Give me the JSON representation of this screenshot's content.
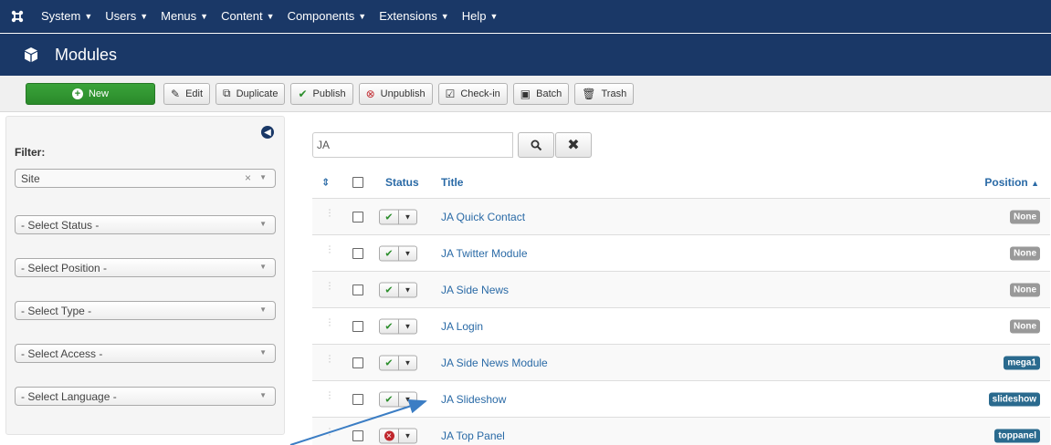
{
  "topnav": {
    "items": [
      {
        "label": "System"
      },
      {
        "label": "Users"
      },
      {
        "label": "Menus"
      },
      {
        "label": "Content"
      },
      {
        "label": "Components"
      },
      {
        "label": "Extensions"
      },
      {
        "label": "Help"
      }
    ]
  },
  "header": {
    "title": "Modules"
  },
  "toolbar": {
    "new": "New",
    "edit": "Edit",
    "duplicate": "Duplicate",
    "publish": "Publish",
    "unpublish": "Unpublish",
    "checkin": "Check-in",
    "batch": "Batch",
    "trash": "Trash"
  },
  "sidebar": {
    "filter_label": "Filter:",
    "site_value": "Site",
    "status": "- Select Status -",
    "position": "- Select Position -",
    "type": "- Select Type -",
    "access": "- Select Access -",
    "language": "- Select Language -"
  },
  "search": {
    "value": "JA"
  },
  "table": {
    "headers": {
      "status": "Status",
      "title": "Title",
      "position": "Position"
    },
    "rows": [
      {
        "title": "JA Quick Contact",
        "position": "None",
        "published": true
      },
      {
        "title": "JA Twitter Module",
        "position": "None",
        "published": true
      },
      {
        "title": "JA Side News",
        "position": "None",
        "published": true
      },
      {
        "title": "JA Login",
        "position": "None",
        "published": true
      },
      {
        "title": "JA Side News Module",
        "position": "mega1",
        "published": true
      },
      {
        "title": "JA Slideshow",
        "position": "slideshow",
        "published": true
      },
      {
        "title": "JA Top Panel",
        "position": "toppanel",
        "published": false
      }
    ]
  },
  "colors": {
    "nav_bg": "#1a3867",
    "link": "#2a6aa6",
    "badge_none": "#999999",
    "badge_position": "#2a6a8e",
    "arrow": "#3b7dc4"
  }
}
